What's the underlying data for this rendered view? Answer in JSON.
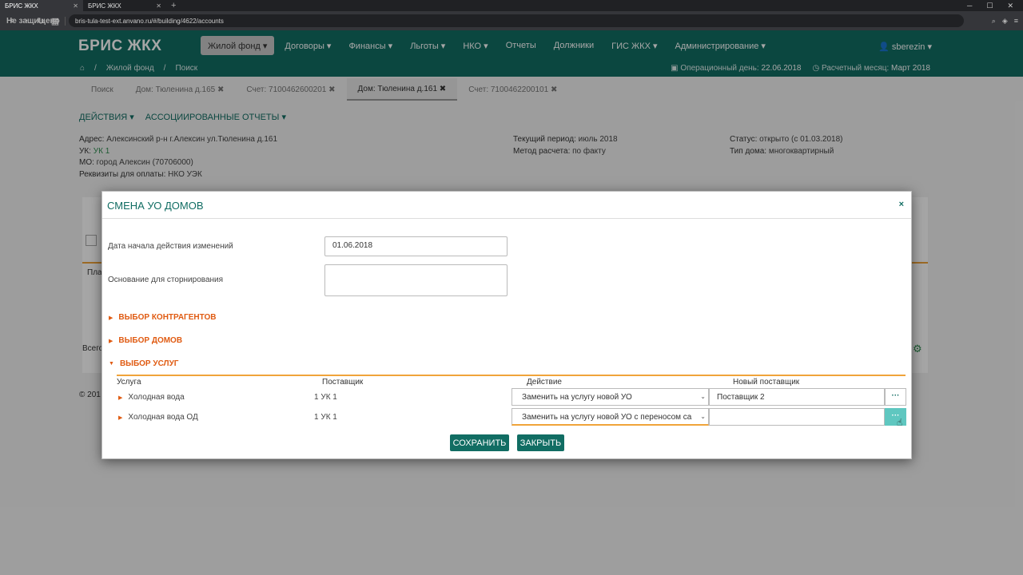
{
  "browser": {
    "tabs": [
      {
        "label": "БРИС ЖКХ"
      },
      {
        "label": "БРИС ЖКХ"
      }
    ],
    "security_label": "Не защищено",
    "url": "bris-tula-test-ext.anvano.ru/#/building/4622/accounts"
  },
  "app": {
    "brand": "БРИС ЖКХ",
    "menu": [
      {
        "label": "Жилой фонд ▾"
      },
      {
        "label": "Договоры ▾"
      },
      {
        "label": "Финансы ▾"
      },
      {
        "label": "Льготы ▾"
      },
      {
        "label": "НКО ▾"
      },
      {
        "label": "Отчеты"
      },
      {
        "label": "Должники"
      },
      {
        "label": "ГИС ЖКХ ▾"
      },
      {
        "label": "Администрирование ▾"
      }
    ],
    "user": "sberezin ▾",
    "breadcrumb": [
      "Жилой фонд",
      "Поиск"
    ],
    "op_day_label": "Операционный день:",
    "op_day_value": "22.06.2018",
    "month_label": "Расчетный месяц:",
    "month_value": "Март 2018"
  },
  "subtabs": [
    {
      "label": "Поиск"
    },
    {
      "label": "Дом: Тюленина д.165 ✖"
    },
    {
      "label": "Счет: 7100462600201 ✖"
    },
    {
      "label": "Дом: Тюленина д.161 ✖"
    },
    {
      "label": "Счет: 7100462200101 ✖"
    }
  ],
  "actions": {
    "actions_label": "ДЕЙСТВИЯ ▾",
    "reports_label": "АССОЦИИРОВАННЫЕ ОТЧЕТЫ ▾"
  },
  "building_info": {
    "address_label": "Адрес:",
    "address_value": "Алексинский р-н г.Алексин ул.Тюленина д.161",
    "uk_label": "УК:",
    "uk_value": "УК 1",
    "mo_label": "МО:",
    "mo_value": "город Алексин (70706000)",
    "payment_label": "Реквизиты для оплаты:",
    "payment_value": "НКО УЭК",
    "period_label": "Текущий период:",
    "period_value": "июль 2018",
    "method_label": "Метод расчета:",
    "method_value": "по факту",
    "status_label": "Статус:",
    "status_value": "открыто (с 01.03.2018)",
    "type_label": "Тип дома:",
    "type_value": "многоквартирный"
  },
  "background_fragments": {
    "pl": "Пла",
    "total": "Всего",
    "year": "© 201"
  },
  "modal": {
    "title": "СМЕНА УО ДОМОВ",
    "close": "×",
    "date_label": "Дата начала действия изменений",
    "date_value": "01.06.2018",
    "reason_label": "Основание для сторнирования",
    "reason_value": "",
    "sections": [
      {
        "label": "ВЫБОР КОНТРАГЕНТОВ"
      },
      {
        "label": "ВЫБОР ДОМОВ"
      },
      {
        "label": "ВЫБОР УСЛУГ"
      }
    ],
    "table_headers": [
      "Услуга",
      "Поставщик",
      "Действие",
      "Новый поставщик"
    ],
    "rows": [
      {
        "service": "Холодная вода",
        "provider": "1 УК 1",
        "action": "Заменить на услугу новой УО",
        "new_provider": "Поставщик 2"
      },
      {
        "service": "Холодная вода ОД",
        "provider": "1 УК 1",
        "action": "Заменить на услугу новой УО с переносом са",
        "new_provider": ""
      }
    ],
    "dots_label": "···",
    "save_label": "СОХРАНИТЬ",
    "close_label": "ЗАКРЫТЬ"
  },
  "colors": {
    "primary": "#116d63",
    "accent": "#e05b12",
    "underline": "#f0a43a"
  }
}
